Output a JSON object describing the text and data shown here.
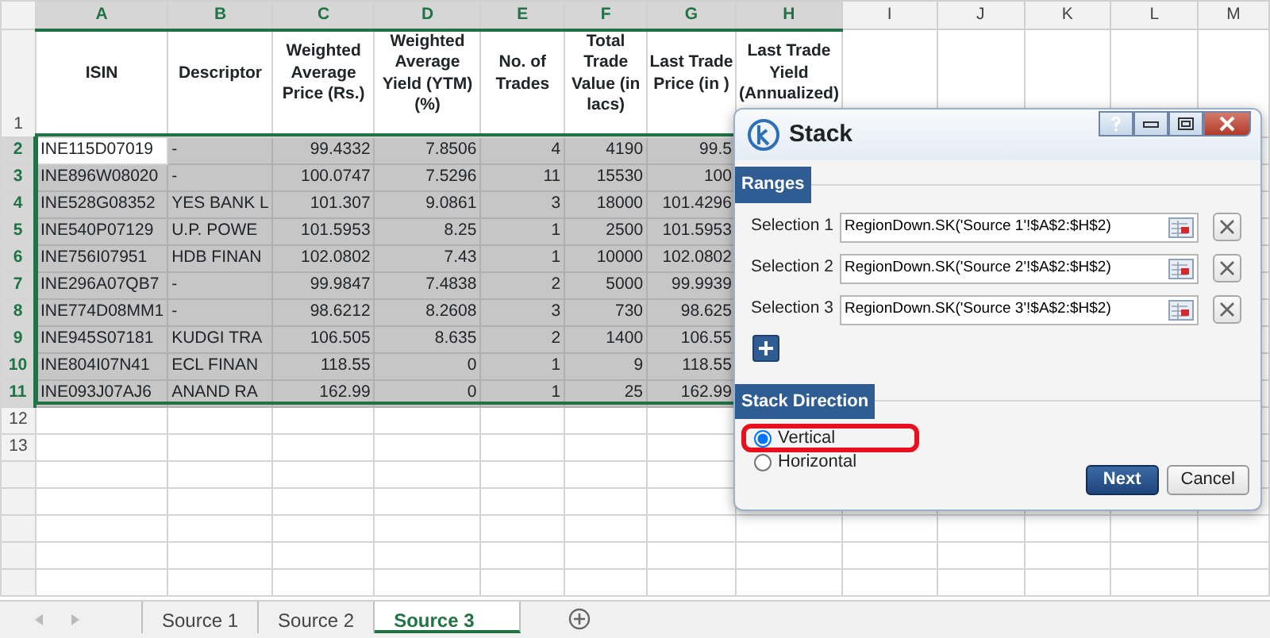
{
  "columns": [
    {
      "letter": "A",
      "selected": true,
      "header": "ISIN",
      "kind": "text"
    },
    {
      "letter": "B",
      "selected": true,
      "header": "Descriptor",
      "kind": "text"
    },
    {
      "letter": "C",
      "selected": true,
      "header": "Weighted Average Price (Rs.)",
      "kind": "number"
    },
    {
      "letter": "D",
      "selected": true,
      "header": "Weighted Average Yield (YTM) (%)",
      "kind": "number"
    },
    {
      "letter": "E",
      "selected": true,
      "header": "No. of Trades",
      "kind": "number"
    },
    {
      "letter": "F",
      "selected": true,
      "header": "Total Trade Value (in lacs)",
      "kind": "number"
    },
    {
      "letter": "G",
      "selected": true,
      "header": "Last Trade Price (in )",
      "kind": "number"
    },
    {
      "letter": "H",
      "selected": true,
      "header": "Last Trade Yield (Annualized)",
      "kind": "number"
    },
    {
      "letter": "I",
      "selected": false
    },
    {
      "letter": "J",
      "selected": false
    },
    {
      "letter": "K",
      "selected": false
    },
    {
      "letter": "L",
      "selected": false
    },
    {
      "letter": "M",
      "selected": false
    }
  ],
  "header_row_number": "1",
  "rows": [
    {
      "number": "2",
      "selected": true,
      "active": true,
      "cells": [
        "INE115D07019",
        "-",
        "99.4332",
        "7.8506",
        "4",
        "4190",
        "99.5"
      ]
    },
    {
      "number": "3",
      "selected": true,
      "active": false,
      "cells": [
        "INE896W08020",
        "-",
        "100.0747",
        "7.5296",
        "11",
        "15530",
        "100"
      ]
    },
    {
      "number": "4",
      "selected": true,
      "active": false,
      "cells": [
        "INE528G08352",
        "YES BANK L",
        "101.307",
        "9.0861",
        "3",
        "18000",
        "101.4296"
      ]
    },
    {
      "number": "5",
      "selected": true,
      "active": false,
      "cells": [
        "INE540P07129",
        "U.P. POWE",
        "101.5953",
        "8.25",
        "1",
        "2500",
        "101.5953"
      ]
    },
    {
      "number": "6",
      "selected": true,
      "active": false,
      "cells": [
        "INE756I07951",
        "HDB FINAN",
        "102.0802",
        "7.43",
        "1",
        "10000",
        "102.0802"
      ]
    },
    {
      "number": "7",
      "selected": true,
      "active": false,
      "cells": [
        "INE296A07QB7",
        "-",
        "99.9847",
        "7.4838",
        "2",
        "5000",
        "99.9939"
      ]
    },
    {
      "number": "8",
      "selected": true,
      "active": false,
      "cells": [
        "INE774D08MM1",
        "-",
        "98.6212",
        "8.2608",
        "3",
        "730",
        "98.625"
      ]
    },
    {
      "number": "9",
      "selected": true,
      "active": false,
      "cells": [
        "INE945S07181",
        "KUDGI TRA",
        "106.505",
        "8.635",
        "2",
        "1400",
        "106.55"
      ]
    },
    {
      "number": "10",
      "selected": true,
      "active": false,
      "cells": [
        "INE804I07N41",
        "ECL FINAN",
        "118.55",
        "0",
        "1",
        "9",
        "118.55"
      ]
    },
    {
      "number": "11",
      "selected": true,
      "active": false,
      "cells": [
        "INE093J07AJ6",
        "ANAND RA",
        "162.99",
        "0",
        "1",
        "25",
        "162.99"
      ]
    },
    {
      "number": "12",
      "selected": false,
      "cells": []
    },
    {
      "number": "13",
      "selected": false,
      "cells": []
    }
  ],
  "sheet_tabs": [
    {
      "label": "Source 1",
      "selected": false
    },
    {
      "label": "Source 2",
      "selected": false
    },
    {
      "label": "Source 3",
      "selected": true
    }
  ],
  "dialog": {
    "title": "Stack",
    "ranges_heading": "Ranges",
    "selections": [
      {
        "label": "Selection 1",
        "value": "RegionDown.SK('Source 1'!$A$2:$H$2)"
      },
      {
        "label": "Selection 2",
        "value": "RegionDown.SK('Source 2'!$A$2:$H$2)"
      },
      {
        "label": "Selection 3",
        "value": "RegionDown.SK('Source 3'!$A$2:$H$2)"
      }
    ],
    "direction_heading": "Stack Direction",
    "directions": [
      {
        "label": "Vertical",
        "selected": true,
        "highlighted": true
      },
      {
        "label": "Horizontal",
        "selected": false,
        "highlighted": false
      }
    ],
    "buttons": [
      {
        "label": "Next",
        "kind": "primary"
      },
      {
        "label": "Cancel",
        "kind": "secondary"
      }
    ]
  }
}
